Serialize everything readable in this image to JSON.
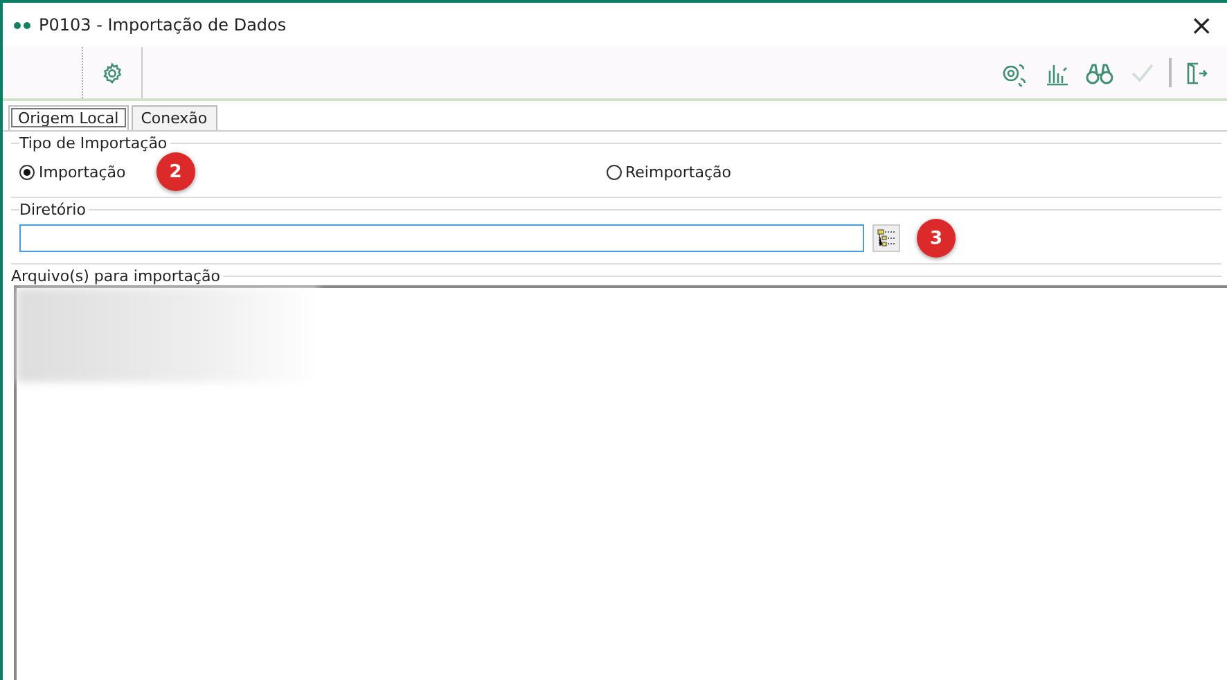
{
  "window": {
    "title": "P0103 - Importação de Dados",
    "close": "×"
  },
  "toolbar": {
    "left": [
      {
        "kind": "settings",
        "disabled": false
      }
    ],
    "right": [
      {
        "kind": "gears",
        "disabled": false
      },
      {
        "kind": "chart",
        "disabled": false
      },
      {
        "kind": "binoculars",
        "disabled": false
      },
      {
        "kind": "check",
        "disabled": true
      },
      {
        "kind": "exit",
        "disabled": false
      }
    ]
  },
  "tabs": [
    {
      "label": "Origem Local",
      "selected": true
    },
    {
      "label": "Conexão",
      "selected": false
    }
  ],
  "import_type": {
    "legend": "Tipo de Importação",
    "options": [
      {
        "label": "Importação",
        "selected": true
      },
      {
        "label": "Reimportação",
        "selected": false
      }
    ]
  },
  "directory": {
    "legend": "Diretório"
  },
  "files": {
    "legend": "Arquivo(s) para importação"
  },
  "callouts": [
    "2",
    "3"
  ]
}
